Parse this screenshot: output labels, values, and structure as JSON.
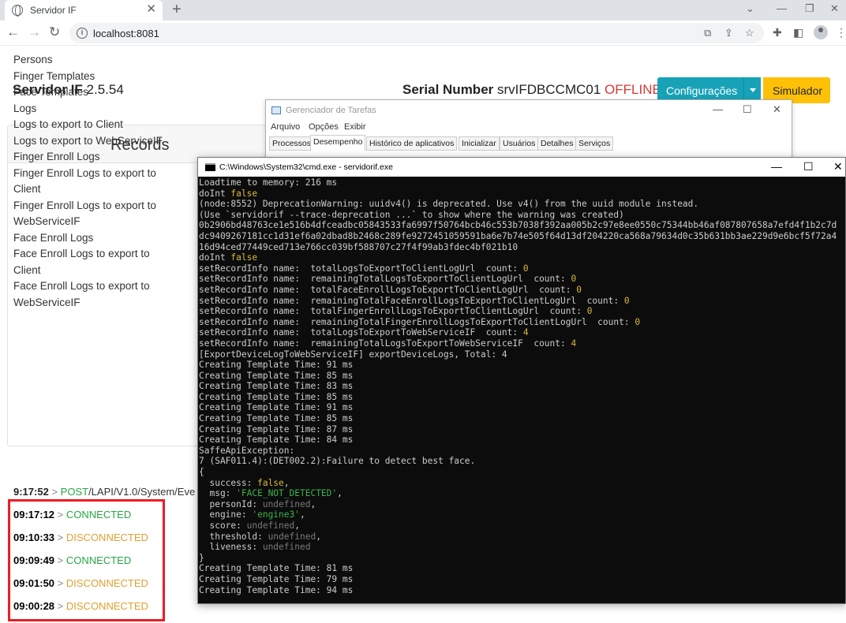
{
  "browser": {
    "tab_title": "Servidor IF",
    "tab_close": "✕",
    "new_tab": "+",
    "url": "localhost:8081",
    "window_controls": [
      "⌄",
      "—",
      "❐",
      "✕"
    ]
  },
  "app": {
    "name": "Servidor IF",
    "version": "2.5.54",
    "serial_label": "Serial Number",
    "serial_value": "srvIFDBCCMC01",
    "status": "OFFLINE",
    "config_button": "Configurações",
    "simulator_button": "Simulador"
  },
  "records": {
    "title": "Records",
    "items": [
      "Persons",
      "Finger Templates",
      "Face Templates",
      "Logs",
      "Logs to export to Client",
      "Logs to export to WebServiceIF",
      "Finger Enroll Logs",
      "Finger Enroll Logs to export to",
      "Client",
      "Finger Enroll Logs to export to",
      "WebServiceIF",
      "Face Enroll Logs",
      "Face Enroll Logs to export to",
      "Client",
      "Face Enroll Logs to export to",
      "WebServiceIF"
    ]
  },
  "log": {
    "post_time": "9:17:52",
    "post_method": "POST",
    "post_path": "/LAPI/V1.0/System/Eve",
    "events": [
      {
        "time": "09:17:12",
        "status": "CONNECTED"
      },
      {
        "time": "09:10:33",
        "status": "DISCONNECTED"
      },
      {
        "time": "09:09:49",
        "status": "CONNECTED"
      },
      {
        "time": "09:01:50",
        "status": "DISCONNECTED"
      },
      {
        "time": "09:00:28",
        "status": "DISCONNECTED"
      }
    ]
  },
  "taskmgr": {
    "title": "Gerenciador de Tarefas",
    "menu": [
      "Arquivo",
      "Opções",
      "Exibir"
    ],
    "tabs": [
      "Processos",
      "Desempenho",
      "Histórico de aplicativos",
      "Inicializar",
      "Usuários",
      "Detalhes",
      "Serviços"
    ],
    "active_tab": "Desempenho",
    "controls": [
      "—",
      "☐",
      "✕"
    ]
  },
  "cmd": {
    "title": "C:\\Windows\\System32\\cmd.exe - servidorif.exe",
    "controls": [
      "—",
      "☐",
      "✕"
    ],
    "lines": [
      [
        [
          "Loadtime to memory: 216 ms",
          ""
        ]
      ],
      [
        [
          "doInt ",
          ""
        ],
        [
          "false",
          "y"
        ]
      ],
      [
        [
          "(node:8552) DeprecationWarning: uuidv4() is deprecated. Use v4() from the uuid module instead.",
          ""
        ]
      ],
      [
        [
          "(Use `servidorif --trace-deprecation ...` to show where the warning was created)",
          ""
        ]
      ],
      [
        [
          "0b2906bd48763ce1e516b4dfceadbc05843533fa6997f50764bcb46c553b7038f392aa005b2c97e8ee0550c75344bb46af087807658a7efd4f1b2c7d",
          ""
        ]
      ],
      [
        [
          "dc9409267181cc1d31ef6a02dbad8b2468c289fe9272451059591ba6e7b74e505f64d13df204220ca568a79634d0c35b631bb3ae229d9e6bcf5f72a4",
          ""
        ]
      ],
      [
        [
          "16d94ced77449ced713e766cc039bf588707c27f4f99ab3fdec4bf021b10",
          ""
        ]
      ],
      [
        [
          "doInt ",
          ""
        ],
        [
          "false",
          "y"
        ]
      ],
      [
        [
          "setRecordInfo name:  totalLogsToExportToClientLogUrl  count: ",
          ""
        ],
        [
          "0",
          "y"
        ]
      ],
      [
        [
          "setRecordInfo name:  remainingTotalLogsToExportToClientLogUrl  count: ",
          ""
        ],
        [
          "0",
          "y"
        ]
      ],
      [
        [
          "setRecordInfo name:  totalFaceEnrollLogsToExportToClientLogUrl  count: ",
          ""
        ],
        [
          "0",
          "y"
        ]
      ],
      [
        [
          "setRecordInfo name:  remainingTotalFaceEnrollLogsToExportToClientLogUrl  count: ",
          ""
        ],
        [
          "0",
          "y"
        ]
      ],
      [
        [
          "setRecordInfo name:  totalFingerEnrollLogsToExportToClientLogUrl  count: ",
          ""
        ],
        [
          "0",
          "y"
        ]
      ],
      [
        [
          "setRecordInfo name:  remainingTotalFingerEnrollLogsToExportToClientLogUrl  count: ",
          ""
        ],
        [
          "0",
          "y"
        ]
      ],
      [
        [
          "setRecordInfo name:  totalLogsToExportToWebServiceIF  count: ",
          ""
        ],
        [
          "4",
          "y"
        ]
      ],
      [
        [
          "setRecordInfo name:  remainingTotalLogsToExportToWebServiceIF  count: ",
          ""
        ],
        [
          "4",
          "y"
        ]
      ],
      [
        [
          "[ExportDeviceLogToWebServiceIF] exportDeviceLogs, Total: 4",
          ""
        ]
      ],
      [
        [
          "Creating Template Time: 91 ms",
          ""
        ]
      ],
      [
        [
          "Creating Template Time: 85 ms",
          ""
        ]
      ],
      [
        [
          "Creating Template Time: 83 ms",
          ""
        ]
      ],
      [
        [
          "Creating Template Time: 85 ms",
          ""
        ]
      ],
      [
        [
          "Creating Template Time: 91 ms",
          ""
        ]
      ],
      [
        [
          "Creating Template Time: 85 ms",
          ""
        ]
      ],
      [
        [
          "Creating Template Time: 87 ms",
          ""
        ]
      ],
      [
        [
          "Creating Template Time: 84 ms",
          ""
        ]
      ],
      [
        [
          "SaffeApiException:",
          ""
        ]
      ],
      [
        [
          "7 (SAF011.4):(DET002.2):Failure to detect best face.",
          ""
        ]
      ],
      [
        [
          "{",
          ""
        ]
      ],
      [
        [
          "  success: ",
          ""
        ],
        [
          "false",
          "y"
        ],
        [
          ",",
          ""
        ]
      ],
      [
        [
          "  msg: ",
          ""
        ],
        [
          "'FACE_NOT_DETECTED'",
          "g"
        ],
        [
          ",",
          ""
        ]
      ],
      [
        [
          "  personId: ",
          ""
        ],
        [
          "undefined",
          "d"
        ],
        [
          ",",
          ""
        ]
      ],
      [
        [
          "  engine: ",
          ""
        ],
        [
          "'engine3'",
          "g"
        ],
        [
          ",",
          ""
        ]
      ],
      [
        [
          "  score: ",
          ""
        ],
        [
          "undefined",
          "d"
        ],
        [
          ",",
          ""
        ]
      ],
      [
        [
          "  threshold: ",
          ""
        ],
        [
          "undefined",
          "d"
        ],
        [
          ",",
          ""
        ]
      ],
      [
        [
          "  liveness: ",
          ""
        ],
        [
          "undefined",
          "d"
        ]
      ],
      [
        [
          "}",
          ""
        ]
      ],
      [
        [
          "Creating Template Time: 81 ms",
          ""
        ]
      ],
      [
        [
          "Creating Template Time: 79 ms",
          ""
        ]
      ],
      [
        [
          "Creating Template Time: 94 ms",
          ""
        ]
      ]
    ]
  }
}
